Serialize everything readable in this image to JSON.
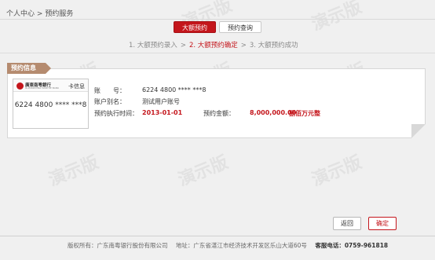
{
  "breadcrumb": {
    "home": "个人中心",
    "sep": ">",
    "current": "预约服务"
  },
  "tabs": [
    {
      "label": "大额预约",
      "active": true
    },
    {
      "label": "预约查询",
      "active": false
    }
  ],
  "steps": [
    {
      "label": "1. 大额预约录入",
      "current": false
    },
    {
      "label": "2. 大额预约确定",
      "current": true
    },
    {
      "label": "3. 大额预约成功",
      "current": false
    }
  ],
  "panel": {
    "tag": "预约信息",
    "card": {
      "bank_name": "廣東南粵銀行",
      "bank_sub": "GUANGDONG NANYUE BANK",
      "info_label": "卡信息",
      "number": "6224 4800 **** ***8"
    },
    "fields": {
      "account_label": "账　　号：",
      "account_value": "6224 4800 **** ***8",
      "alias_label": "账户别名：",
      "alias_value": "测试用户账号",
      "date_label": "预约执行时间：",
      "date_value": "2013-01-01",
      "amount_label": "预约金额：",
      "amount_value": "8,000,000.00",
      "amount_upper": "捌佰万元整"
    }
  },
  "buttons": {
    "back": "返回",
    "confirm": "确定"
  },
  "footer": {
    "copyright": "版权所有：广东南粤银行股份有限公司",
    "address": "地址：广东省湛江市经济技术开发区乐山大道60号",
    "hotline": "客服电话：0759-961818"
  },
  "watermark": "演示版",
  "colors": {
    "accent": "#c4161c",
    "tag": "#b58b6f",
    "background": "#f0f0f0"
  }
}
